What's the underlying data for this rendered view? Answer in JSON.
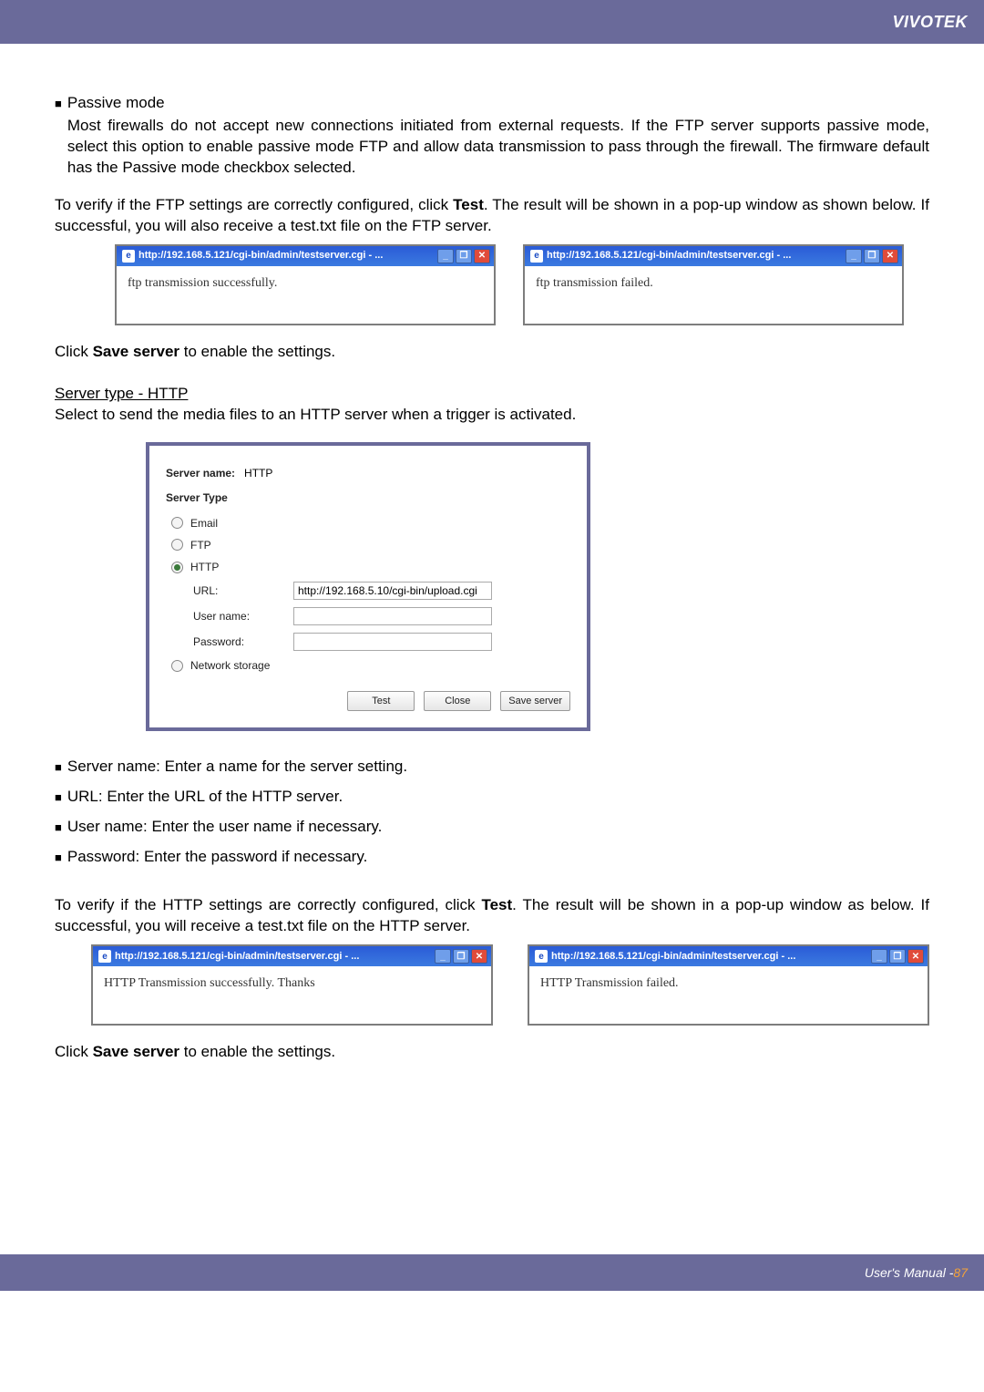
{
  "header": {
    "brand": "VIVOTEK"
  },
  "passive": {
    "title": "Passive mode",
    "desc": "Most firewalls do not accept new connections initiated from external requests. If the FTP server supports passive mode, select this option to enable passive mode FTP and allow data transmission to pass through the firewall. The firmware default has the Passive mode checkbox selected."
  },
  "ftp_verify_pre": "To verify if the FTP settings are correctly configured, click ",
  "ftp_verify_bold": "Test",
  "ftp_verify_post": ". The result will be shown in a pop-up window as shown below. If successful, you will also receive a test.txt file on the FTP server.",
  "popup_title": "http://192.168.5.121/cgi-bin/admin/testserver.cgi - ...",
  "ftp_popup_success": "ftp transmission successfully.",
  "ftp_popup_fail": "ftp transmission failed.",
  "save_pre": "Click ",
  "save_bold": "Save server",
  "save_post": " to enable the settings.",
  "http_heading": "Server type - HTTP",
  "http_intro": "Select to send the media files to an HTTP server when a trigger is activated.",
  "config": {
    "server_name_label": "Server name:",
    "server_name_value": "HTTP",
    "server_type_label": "Server Type",
    "opt_email": "Email",
    "opt_ftp": "FTP",
    "opt_http": "HTTP",
    "url_label": "URL:",
    "url_value": "http://192.168.5.10/cgi-bin/upload.cgi",
    "user_label": "User name:",
    "pass_label": "Password:",
    "opt_net": "Network storage",
    "btn_test": "Test",
    "btn_close": "Close",
    "btn_save": "Save server"
  },
  "desc_server_name": "Server name: Enter a name for the server setting.",
  "desc_url": "URL: Enter the URL of the HTTP server.",
  "desc_user": "User name: Enter the user name if necessary.",
  "desc_pass": "Password: Enter the password if necessary.",
  "http_verify_pre": "To verify if the HTTP settings are correctly configured, click ",
  "http_verify_bold": "Test",
  "http_verify_post": ". The result will be shown in a pop-up window as below. If successful, you will receive a test.txt file on the HTTP server.",
  "http_popup_success": "HTTP Transmission successfully. Thanks",
  "http_popup_fail": "HTTP Transmission failed.",
  "footer": {
    "label": "User's Manual - ",
    "page": "87"
  },
  "win_btn_min": "_",
  "win_btn_max": "❐",
  "win_btn_close": "✕"
}
